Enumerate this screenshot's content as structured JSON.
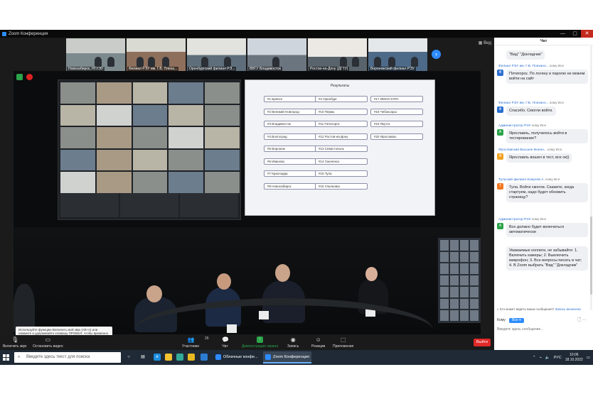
{
  "window": {
    "title": "Zoom Конференция",
    "controls": [
      "—",
      "▢",
      "✕"
    ]
  },
  "thumbnails": [
    {
      "label": "Новосибирск, НГУЭУ"
    },
    {
      "label": "Филиал РЭУ им. Г.В. Плеха..."
    },
    {
      "label": "Оренбургский филиал РЭ..."
    },
    {
      "label": "ВВГУ Владивосток"
    },
    {
      "label": "Ростов-на-Дону (ДГТУ)"
    },
    {
      "label": "Воронежский филиал РЭУ"
    }
  ],
  "view_button": "Вид",
  "results_screen": {
    "title": "Результаты",
    "items": [
      "#1 Брянск",
      "#2 Оренбург",
      "#17 ИМАО КУРА",
      "#2 Великий Новгород",
      "#10 Пермь",
      "#18 Чебоксары",
      "#3 Владивосток",
      "#11 Пятигорск",
      "#19 Якутск",
      "#4 Волгоград",
      "#12 Ростов-на-Дону",
      "#20 Ярославль",
      "#5 Воронеж",
      "#13 Севастополь",
      "#6 Иваново",
      "#14 Смоленск",
      "#7 Краснодар",
      "#15 Тула",
      "#8 Новосибирск",
      "#16 Ульяновск"
    ]
  },
  "tooltip": "Используйте функцию Включить мой звук (Alt+A) или нажмите и удерживайте клавишу ПРОБЕЛ, чтобы временно включить звук.",
  "toolbar": {
    "unmute": "Включить звук",
    "video": "Остановить видео",
    "participants": "Участники",
    "participants_count": "26",
    "chat": "Чат",
    "share": "Демонстрация экрана",
    "record": "Запись",
    "reactions": "Реакции",
    "apps": "Приложения",
    "leave": "Выйти"
  },
  "chat": {
    "header": "Чат",
    "messages": [
      {
        "sender": "",
        "to": "",
        "text": "\"Вид\" \"Докладчик\"",
        "avatar": "",
        "color": ""
      },
      {
        "sender": "Филиал РЭУ им. Г.В. Плехано...",
        "to": "кому Все",
        "text": "Пятигорск. По логину и паролю не можем войти на сайт",
        "avatar": "Ф",
        "color": "#2d6fd0"
      },
      {
        "sender": "Филиал РЭУ им. Г.В. Плехано...",
        "to": "кому Все",
        "text": "Спасибо. Смогли войти.",
        "avatar": "Ф",
        "color": "#2d6fd0"
      },
      {
        "sender": "Администратор РЭУ",
        "to": "кому Все",
        "text": "Ярославль, получилось войти в тестирование?",
        "avatar": "А",
        "color": "#2aa34a"
      },
      {
        "sender": "Ярославский Высшее Военн...",
        "to": "кому Все",
        "text": "Ярославль вошел в тест, все ок))",
        "avatar": "Я",
        "color": "#f0a020"
      },
      {
        "sender": "Тульский филиал Кожухов А.",
        "to": "кому Все",
        "text": "Тула. Войти смогли. Скажите, когда стартуем, надо будет обновить страницу?",
        "avatar": "Т",
        "color": "#f07820"
      },
      {
        "sender": "Администратор РЭУ",
        "to": "кому Все",
        "text": "Все должно будет включиться автоматически",
        "avatar": "А",
        "color": "#2aa34a"
      },
      {
        "sender": "",
        "to": "",
        "text": "Уважаемые коллеги, не забывайте: 1. Включить камеры; 2. Выключить микрофон; 3. Все вопросы писать в чат; 4. В Zoom выбрать \"Вид\" \"Докладчик\"",
        "avatar": "",
        "color": ""
      }
    ],
    "notice_prefix": "Кто может видеть ваши сообщения?",
    "notice_link": "Запись включена",
    "to_label": "Кому:",
    "to_value": "Все",
    "input_placeholder": "Введите здесь сообщение..."
  },
  "taskbar": {
    "search_placeholder": "Введите здесь текст для поиска",
    "apps": [
      "Облачные конфе...",
      "Zoom Конференция"
    ],
    "lang": "РУС",
    "time": "10:06",
    "date": "18.10.2022"
  }
}
